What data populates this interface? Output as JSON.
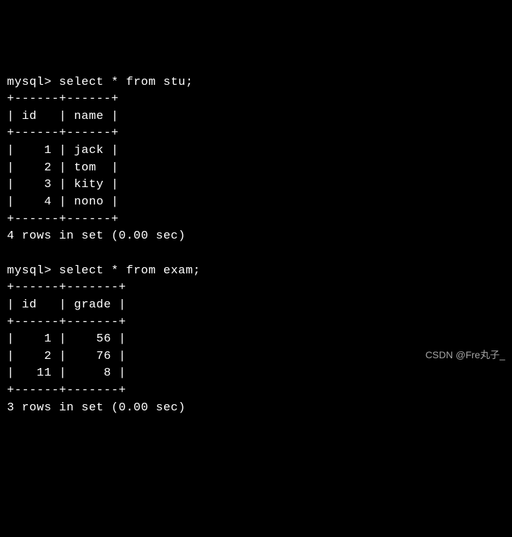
{
  "query1": {
    "prompt": "mysql> ",
    "sql": "select * from stu;",
    "border": "+------+------+",
    "header": "| id   | name |",
    "rows": [
      "|    1 | jack |",
      "|    2 | tom  |",
      "|    3 | kity |",
      "|    4 | nono |"
    ],
    "footer": "4 rows in set (0.00 sec)"
  },
  "query2": {
    "prompt": "mysql> ",
    "sql": "select * from exam;",
    "border": "+------+-------+",
    "header": "| id   | grade |",
    "rows": [
      "|    1 |    56 |",
      "|    2 |    76 |",
      "|   11 |     8 |"
    ],
    "footer": "3 rows in set (0.00 sec)"
  },
  "watermark": "CSDN @Fre丸子_"
}
